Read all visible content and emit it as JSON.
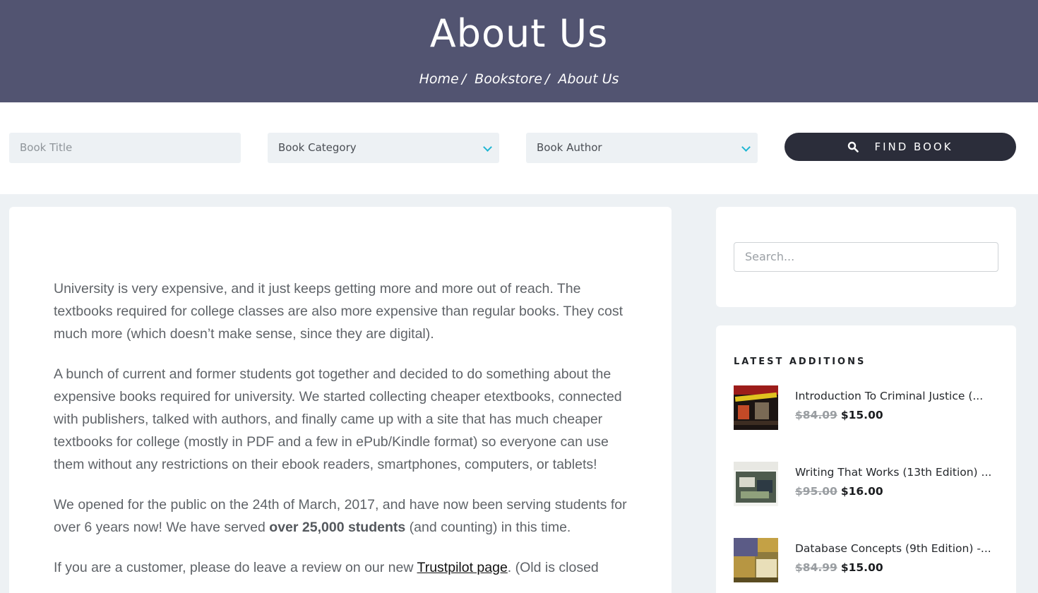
{
  "hero": {
    "title": "About Us",
    "breadcrumb": [
      "Home",
      "Bookstore",
      "About Us"
    ],
    "bg_color": "#525471"
  },
  "filters": {
    "title_placeholder": "Book Title",
    "category_label": "Book Category",
    "author_label": "Book Author",
    "find_label": "FIND BOOK",
    "find_icon": "search-icon",
    "chevron_color": "#1fb6d3",
    "button_color": "#2b2d3a"
  },
  "content": {
    "p1": "University is very expensive, and it just keeps getting more and more out of reach. The textbooks required for college classes are also more expensive than regular books. They cost much more (which doesn’t make sense, since they are digital).",
    "p2": "A bunch of current and former students got together and decided to do something about the expensive books required for university. We started collecting cheaper etextbooks, connected with publishers, talked with authors, and finally came up with a site that has much cheaper textbooks for college (mostly in PDF and a few in ePub/Kindle format) so everyone can use them without any restrictions on their ebook readers, smartphones, computers, or tablets!",
    "p3_a": "We opened for the public on the 24th of March, 2017, and have now been serving students for over 6 years now! We have served ",
    "p3_bold": "over 25,000 students",
    "p3_b": " (and counting) in this time.",
    "p4_a": "If you are a customer, please do leave a review on our new ",
    "p4_link": "Trustpilot page",
    "p4_b": ". (Old is closed"
  },
  "sidebar": {
    "search_placeholder": "Search...",
    "latest_heading": "LATEST ADDITIONS",
    "items": [
      {
        "title": "Introduction To Criminal Justice (...",
        "old_price": "$84.09",
        "new_price": "$15.00"
      },
      {
        "title": "Writing That Works (13th Edition) ...",
        "old_price": "$95.00",
        "new_price": "$16.00"
      },
      {
        "title": "Database Concepts (9th Edition) -...",
        "old_price": "$84.99",
        "new_price": "$15.00"
      }
    ]
  }
}
